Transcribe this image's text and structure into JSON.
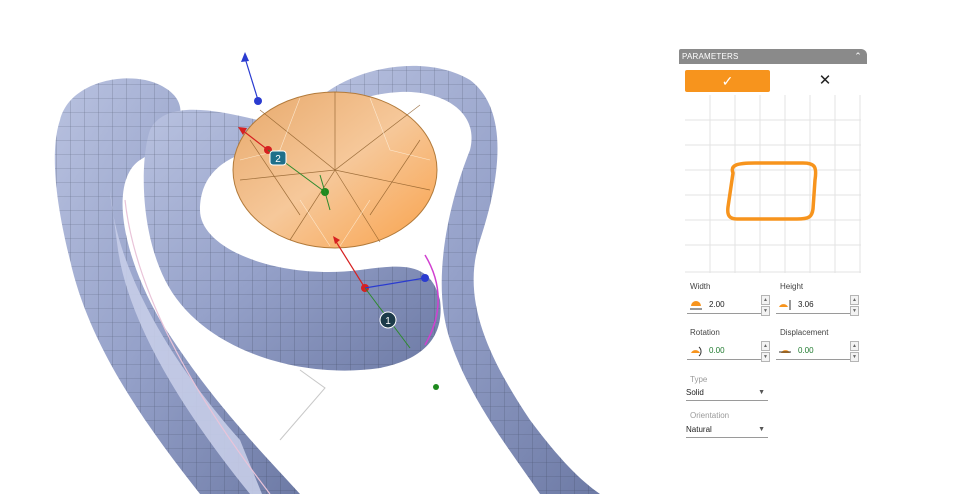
{
  "panel": {
    "title": "PARAMETERS",
    "collapse_icon": "chevron-up-icon",
    "ok_icon": "checkmark-icon",
    "ok_symbol": "✓",
    "cancel_icon": "close-icon",
    "cancel_symbol": "✕",
    "accent_color": "#f7941d"
  },
  "fields": {
    "width": {
      "label": "Width",
      "value": "2.00"
    },
    "height": {
      "label": "Height",
      "value": "3.06"
    },
    "rotation": {
      "label": "Rotation",
      "value": "0.00"
    },
    "displacement": {
      "label": "Displacement",
      "value": "0.00"
    }
  },
  "dropdowns": {
    "type": {
      "label": "Type",
      "value": "Solid"
    },
    "orientation": {
      "label": "Orientation",
      "value": "Natural"
    }
  },
  "viewport": {
    "markers": [
      {
        "label": "1"
      },
      {
        "label": "2"
      }
    ],
    "mesh_color": "#9aa6cc",
    "gem_color": "#f7b35e"
  }
}
